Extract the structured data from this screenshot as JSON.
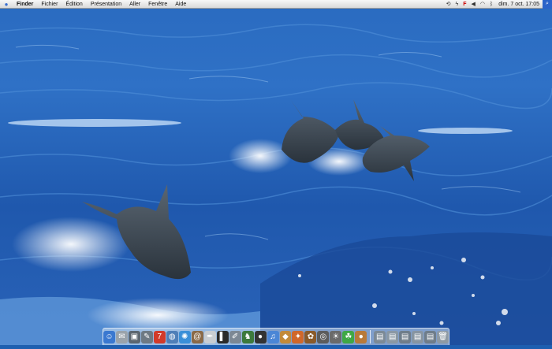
{
  "menubar": {
    "apple_icon": "apple-icon",
    "app_name": "Finder",
    "menus": [
      "Fichier",
      "Édition",
      "Présentation",
      "Aller",
      "Fenêtre",
      "Aide"
    ],
    "status_icons": [
      "sync-icon",
      "power-icon",
      "flag-icon",
      "volume-icon",
      "wifi-icon",
      "bluetooth-icon"
    ],
    "clock": "dim. 7 oct. 17:05",
    "spotlight_icon": "spotlight-search-icon"
  },
  "dock": {
    "apps": [
      {
        "name": "finder-icon",
        "glyph": "☺",
        "color": "#3a78d0"
      },
      {
        "name": "mail-stamp-icon",
        "glyph": "✉",
        "color": "#9aa3ab"
      },
      {
        "name": "preview-icon",
        "glyph": "▣",
        "color": "#5c6670"
      },
      {
        "name": "pencil-icon",
        "glyph": "✎",
        "color": "#6e7a84"
      },
      {
        "name": "ical-icon",
        "glyph": "7",
        "color": "#d23a2a"
      },
      {
        "name": "globe-icon",
        "glyph": "◍",
        "color": "#4f7fb8"
      },
      {
        "name": "safari-compass-icon",
        "glyph": "✺",
        "color": "#3a8fd8"
      },
      {
        "name": "address-book-icon",
        "glyph": "@",
        "color": "#8a6a48"
      },
      {
        "name": "textedit-icon",
        "glyph": "✒",
        "color": "#c8cdd2"
      },
      {
        "name": "terminal-icon",
        "glyph": "▌",
        "color": "#2a2a2a"
      },
      {
        "name": "pen-tool-icon",
        "glyph": "✐",
        "color": "#7c8894"
      },
      {
        "name": "chess-icon",
        "glyph": "♞",
        "color": "#3c7a3c"
      },
      {
        "name": "dvd-player-icon",
        "glyph": "●",
        "color": "#333333"
      },
      {
        "name": "itunes-icon",
        "glyph": "♫",
        "color": "#4b86d6"
      },
      {
        "name": "photo-album-icon",
        "glyph": "◆",
        "color": "#c28a3a"
      },
      {
        "name": "movie-icon",
        "glyph": "✦",
        "color": "#d0672a"
      },
      {
        "name": "grapher-icon",
        "glyph": "✿",
        "color": "#8a5a2a"
      },
      {
        "name": "photo-booth-icon",
        "glyph": "◎",
        "color": "#5c5c5c"
      },
      {
        "name": "sun-icon",
        "glyph": "☀",
        "color": "#6a6a6a"
      },
      {
        "name": "chat-icon",
        "glyph": "☘",
        "color": "#3fa845"
      },
      {
        "name": "network-utility-icon",
        "glyph": "●",
        "color": "#b87a3a"
      }
    ],
    "documents": [
      {
        "name": "document-stack-icon-1",
        "glyph": "▤",
        "color": "#7c8a96"
      },
      {
        "name": "document-stack-icon-2",
        "glyph": "▤",
        "color": "#8a98a4"
      },
      {
        "name": "document-stack-icon-3",
        "glyph": "▤",
        "color": "#6f7d8a"
      },
      {
        "name": "document-stack-icon-4",
        "glyph": "▤",
        "color": "#8795a2"
      },
      {
        "name": "document-stack-icon-5",
        "glyph": "▤",
        "color": "#6f7d8a"
      },
      {
        "name": "trash-icon",
        "glyph": "🗑",
        "color": "#8e9aa4"
      }
    ]
  },
  "wallpaper": {
    "subject": "ocean-with-dolphins",
    "colors": {
      "deep": "#1d55a8",
      "mid": "#3a7ed0",
      "light": "#7ab3ea",
      "foam": "#e8f4ff",
      "dolphin": "#3b4550"
    }
  }
}
